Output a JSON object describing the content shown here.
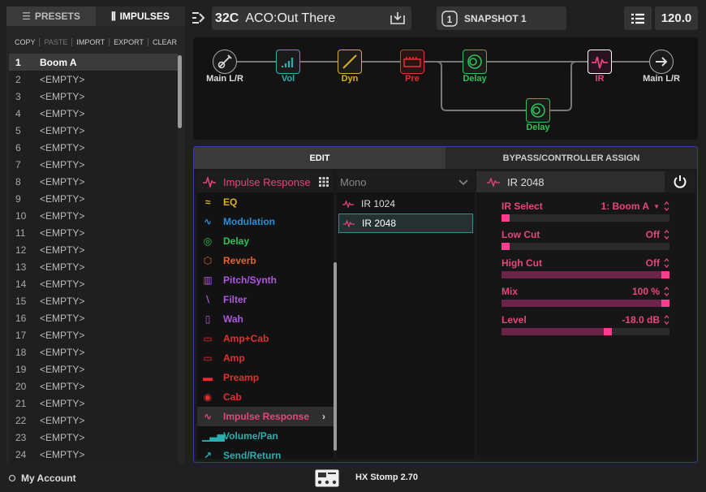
{
  "colors": {
    "accent_pink": "#e6457f",
    "panel_border": "#3a3aa8",
    "selected_model_border": "#3a8c8c"
  },
  "left_panel": {
    "tabs": [
      {
        "label": "PRESETS",
        "icon": "list-icon"
      },
      {
        "label": "IMPULSES",
        "icon": "waveform-icon"
      }
    ],
    "tools": [
      "COPY",
      "PASTE",
      "IMPORT",
      "EXPORT",
      "CLEAR"
    ],
    "items": [
      {
        "num": "1",
        "name": "Boom A"
      },
      {
        "num": "2",
        "name": "<EMPTY>"
      },
      {
        "num": "3",
        "name": "<EMPTY>"
      },
      {
        "num": "4",
        "name": "<EMPTY>"
      },
      {
        "num": "5",
        "name": "<EMPTY>"
      },
      {
        "num": "6",
        "name": "<EMPTY>"
      },
      {
        "num": "7",
        "name": "<EMPTY>"
      },
      {
        "num": "8",
        "name": "<EMPTY>"
      },
      {
        "num": "9",
        "name": "<EMPTY>"
      },
      {
        "num": "10",
        "name": "<EMPTY>"
      },
      {
        "num": "11",
        "name": "<EMPTY>"
      },
      {
        "num": "12",
        "name": "<EMPTY>"
      },
      {
        "num": "13",
        "name": "<EMPTY>"
      },
      {
        "num": "14",
        "name": "<EMPTY>"
      },
      {
        "num": "15",
        "name": "<EMPTY>"
      },
      {
        "num": "16",
        "name": "<EMPTY>"
      },
      {
        "num": "17",
        "name": "<EMPTY>"
      },
      {
        "num": "18",
        "name": "<EMPTY>"
      },
      {
        "num": "19",
        "name": "<EMPTY>"
      },
      {
        "num": "20",
        "name": "<EMPTY>"
      },
      {
        "num": "21",
        "name": "<EMPTY>"
      },
      {
        "num": "22",
        "name": "<EMPTY>"
      },
      {
        "num": "23",
        "name": "<EMPTY>"
      },
      {
        "num": "24",
        "name": "<EMPTY>"
      }
    ]
  },
  "topbar": {
    "preset_number": "32C",
    "preset_name": "ACO:Out There",
    "snapshot_num": "1",
    "snapshot_label": "SNAPSHOT 1",
    "tempo": "120.0"
  },
  "flow": {
    "blocks": [
      {
        "label": "Main L/R",
        "color": "#aaaaaa"
      },
      {
        "label": "Vol",
        "color": "#2ab0b0"
      },
      {
        "label": "Dyn",
        "color": "#d8b020"
      },
      {
        "label": "Pre",
        "color": "#e23030"
      },
      {
        "label": "Delay",
        "color": "#2ec25a"
      },
      {
        "label": "Delay",
        "color": "#2ec25a"
      },
      {
        "label": "IR",
        "color": "#e6457f"
      },
      {
        "label": "Main L/R",
        "color": "#aaaaaa"
      }
    ]
  },
  "panel": {
    "tabs": [
      "EDIT",
      "BYPASS/CONTROLLER ASSIGN"
    ],
    "category_header": "Impulse Response",
    "categories": [
      {
        "label": "EQ",
        "color": "#d8b020",
        "icon": "eq-icon",
        "glyph": "≈"
      },
      {
        "label": "Modulation",
        "color": "#2a8fd8",
        "icon": "modulation-icon",
        "glyph": "∿"
      },
      {
        "label": "Delay",
        "color": "#2ec25a",
        "icon": "delay-icon",
        "glyph": "◎"
      },
      {
        "label": "Reverb",
        "color": "#e8622a",
        "icon": "reverb-icon",
        "glyph": "⬡"
      },
      {
        "label": "Pitch/Synth",
        "color": "#b057e0",
        "icon": "pitch-synth-icon",
        "glyph": "▥"
      },
      {
        "label": "Filter",
        "color": "#b057e0",
        "icon": "filter-icon",
        "glyph": "⧵"
      },
      {
        "label": "Wah",
        "color": "#b057e0",
        "icon": "wah-icon",
        "glyph": "▯"
      },
      {
        "label": "Amp+Cab",
        "color": "#e23030",
        "icon": "amp-cab-icon",
        "glyph": "▭"
      },
      {
        "label": "Amp",
        "color": "#e23030",
        "icon": "amp-icon",
        "glyph": "▭"
      },
      {
        "label": "Preamp",
        "color": "#e23030",
        "icon": "preamp-icon",
        "glyph": "▬"
      },
      {
        "label": "Cab",
        "color": "#e23030",
        "icon": "cab-icon",
        "glyph": "◉"
      },
      {
        "label": "Impulse Response",
        "color": "#e6457f",
        "icon": "impulse-response-icon",
        "glyph": "∿"
      },
      {
        "label": "Volume/Pan",
        "color": "#2ab0b0",
        "icon": "volume-pan-icon",
        "glyph": "▁▃▅"
      },
      {
        "label": "Send/Return",
        "color": "#2ab0b0",
        "icon": "send-return-icon",
        "glyph": "↗"
      }
    ],
    "model_header": "Mono",
    "models": [
      "IR 1024",
      "IR 2048"
    ],
    "param_header": "IR 2048",
    "params": [
      {
        "label": "IR Select",
        "value": "1: Boom A",
        "level": 0.0,
        "dropdown": true
      },
      {
        "label": "Low Cut",
        "value": "Off",
        "level": 0.0
      },
      {
        "label": "High Cut",
        "value": "Off",
        "level": 1.0
      },
      {
        "label": "Mix",
        "value": "100 %",
        "level": 1.0
      },
      {
        "label": "Level",
        "value": "-18.0 dB",
        "level": 0.64
      }
    ]
  },
  "status": {
    "account": "My Account",
    "device": "HX Stomp 2.70"
  }
}
